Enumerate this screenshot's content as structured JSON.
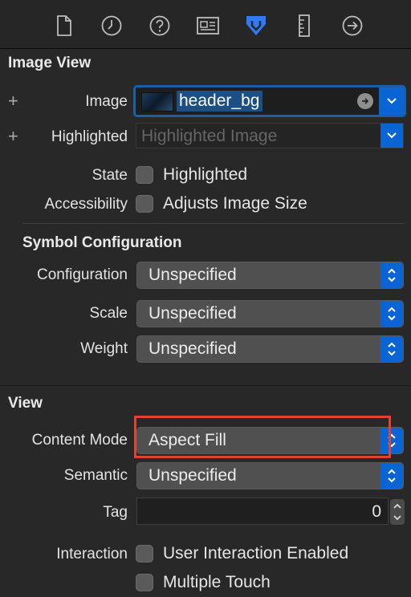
{
  "toolbar": {
    "tabs": [
      {
        "name": "file-inspector-icon"
      },
      {
        "name": "history-inspector-icon"
      },
      {
        "name": "quick-help-icon"
      },
      {
        "name": "identity-inspector-icon"
      },
      {
        "name": "attributes-inspector-icon",
        "selected": true
      },
      {
        "name": "size-inspector-icon"
      },
      {
        "name": "connections-inspector-icon"
      }
    ],
    "selected_color": "#2f7bf5"
  },
  "image_view": {
    "title": "Image View",
    "image_label": "Image",
    "image_value": "header_bg",
    "highlighted_label": "Highlighted",
    "highlighted_placeholder": "Highlighted Image",
    "state_label": "State",
    "state_checkbox_label": "Highlighted",
    "accessibility_label": "Accessibility",
    "accessibility_checkbox_label": "Adjusts Image Size"
  },
  "symbol_configuration": {
    "title": "Symbol Configuration",
    "configuration_label": "Configuration",
    "configuration_value": "Unspecified",
    "scale_label": "Scale",
    "scale_value": "Unspecified",
    "weight_label": "Weight",
    "weight_value": "Unspecified"
  },
  "view": {
    "title": "View",
    "content_mode_label": "Content Mode",
    "content_mode_value": "Aspect Fill",
    "semantic_label": "Semantic",
    "semantic_value": "Unspecified",
    "tag_label": "Tag",
    "tag_value": "0",
    "interaction_label": "Interaction",
    "user_interaction_label": "User Interaction Enabled",
    "multiple_touch_label": "Multiple Touch"
  },
  "colors": {
    "accent": "#0a64d4",
    "highlight_box": "#e0432f"
  }
}
